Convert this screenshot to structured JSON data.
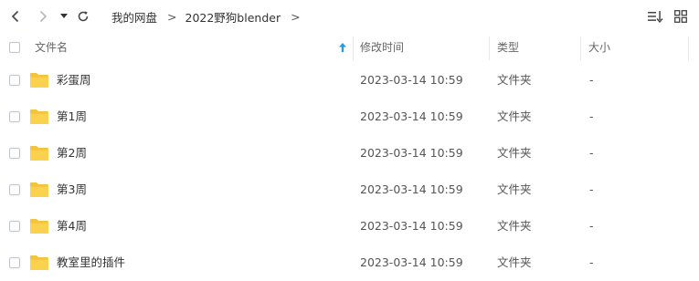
{
  "toolbar": {
    "back_icon": "chevron-left-icon",
    "forward_icon": "chevron-right-icon",
    "history_icon": "caret-down-icon",
    "refresh_icon": "refresh-icon",
    "sort_icon": "sort-list-icon",
    "grid_icon": "grid-view-icon"
  },
  "breadcrumb": {
    "items": [
      "我的网盘",
      "2022野狗blender"
    ],
    "separator": ">"
  },
  "columns": {
    "name": "文件名",
    "modified": "修改时间",
    "type": "类型",
    "size": "大小"
  },
  "files": [
    {
      "name": "彩蛋周",
      "modified": "2023-03-14 10:59",
      "type": "文件夹",
      "size": "-"
    },
    {
      "name": "第1周",
      "modified": "2023-03-14 10:59",
      "type": "文件夹",
      "size": "-"
    },
    {
      "name": "第2周",
      "modified": "2023-03-14 10:59",
      "type": "文件夹",
      "size": "-"
    },
    {
      "name": "第3周",
      "modified": "2023-03-14 10:59",
      "type": "文件夹",
      "size": "-"
    },
    {
      "name": "第4周",
      "modified": "2023-03-14 10:59",
      "type": "文件夹",
      "size": "-"
    },
    {
      "name": "教室里的插件",
      "modified": "2023-03-14 10:59",
      "type": "文件夹",
      "size": "-"
    }
  ],
  "colors": {
    "folder": "#f5c33b",
    "sort_arrow": "#2b9bd8",
    "divider": "#e6e8ec"
  }
}
